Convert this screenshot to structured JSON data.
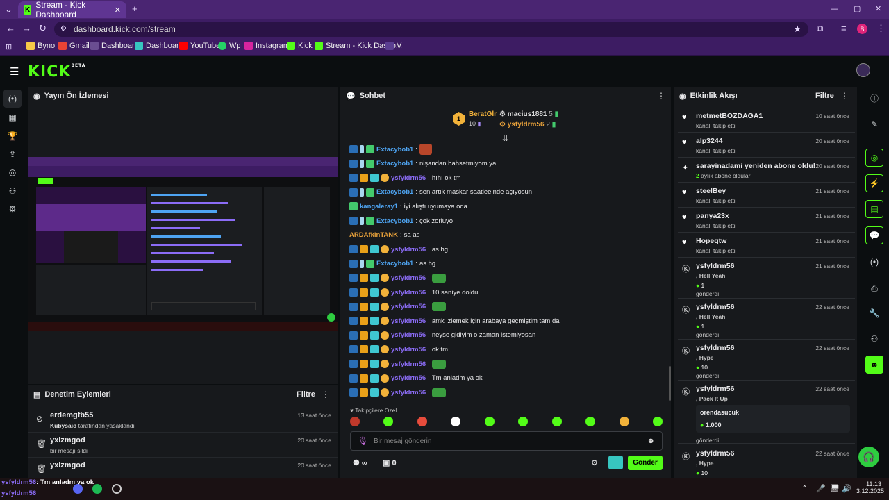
{
  "browser": {
    "tab_title": "Stream - Kick Dashboard",
    "url": "dashboard.kick.com/stream",
    "bookmarks": [
      "Byno",
      "Gmail",
      "Dashboard",
      "Dashboard",
      "YouTube",
      "Wp",
      "Instagram",
      "Kick",
      "Stream - Kick Dashb...",
      "V"
    ],
    "profile_initial": "B"
  },
  "app": {
    "logo": "KICK",
    "logo_badge": "BETA"
  },
  "preview": {
    "title": "Yayın Ön İzlemesi"
  },
  "moderation": {
    "title": "Denetim Eylemleri",
    "filter": "Filtre",
    "items": [
      {
        "user": "erdemgfb55",
        "actor": "Kubysaid",
        "action": "tarafından yasaklandı",
        "time": "13 saat önce",
        "icon": "ban-icon"
      },
      {
        "user": "yxlzmgod",
        "actor": "",
        "action": "bir mesajı sildi",
        "time": "20 saat önce",
        "icon": "trash-icon"
      },
      {
        "user": "yxlzmgod",
        "actor": "",
        "action": "",
        "time": "20 saat önce",
        "icon": "trash-icon"
      }
    ]
  },
  "chat": {
    "title": "Sohbet",
    "top_gifters": [
      {
        "rank": "1",
        "name": "BeratGlr",
        "count": "10"
      },
      {
        "name": "macius1881",
        "count": "5"
      },
      {
        "name": "ysfyldrm56",
        "count": "2"
      }
    ],
    "messages": [
      {
        "user": "Extacybob1",
        "text": "",
        "badges": [
          "tw",
          "wr",
          "gr"
        ],
        "color": "#4ea4f2",
        "emote": true
      },
      {
        "user": "Extacybob1",
        "text": "nişandan bahsetmiyom ya",
        "badges": [
          "tw",
          "wr",
          "gr"
        ],
        "color": "#4ea4f2"
      },
      {
        "user": "ysfyldrm56",
        "text": "hıhı ok tm",
        "badges": [
          "tw",
          "cr",
          "sb",
          "gf"
        ],
        "color": "#8b6cf6"
      },
      {
        "user": "Extacybob1",
        "text": "sen artık maskar saatleeinde açıyosun",
        "badges": [
          "tw",
          "wr",
          "gr"
        ],
        "color": "#4ea4f2"
      },
      {
        "user": "kangaleray1",
        "text": "iyi alıştı uyumaya oda",
        "badges": [
          "gr"
        ],
        "color": "#4ea4f2"
      },
      {
        "user": "Extacybob1",
        "text": "çok zorluyo",
        "badges": [
          "tw",
          "wr",
          "gr"
        ],
        "color": "#4ea4f2"
      },
      {
        "user": "ARDAfkinTANK",
        "text": "sa as",
        "badges": [],
        "color": "#e8a13a"
      },
      {
        "user": "ysfyldrm56",
        "text": "as hg",
        "badges": [
          "tw",
          "cr",
          "sb",
          "gf"
        ],
        "color": "#8b6cf6"
      },
      {
        "user": "Extacybob1",
        "text": "as hg",
        "badges": [
          "tw",
          "wr",
          "gr"
        ],
        "color": "#4ea4f2"
      },
      {
        "user": "ysfyldrm56",
        "text": "",
        "badges": [
          "tw",
          "cr",
          "sb",
          "gf"
        ],
        "color": "#8b6cf6",
        "emote": true
      },
      {
        "user": "ysfyldrm56",
        "text": "10 saniye doldu",
        "badges": [
          "tw",
          "cr",
          "sb",
          "gf"
        ],
        "color": "#8b6cf6"
      },
      {
        "user": "ysfyldrm56",
        "text": "",
        "badges": [
          "tw",
          "cr",
          "sb",
          "gf"
        ],
        "color": "#8b6cf6",
        "emote": true
      },
      {
        "user": "ysfyldrm56",
        "text": "amk izlemek için arabaya geçmiştim tam da",
        "badges": [
          "tw",
          "cr",
          "sb",
          "gf"
        ],
        "color": "#8b6cf6"
      },
      {
        "user": "ysfyldrm56",
        "text": "neyse gidiyim o zaman istemiyosan",
        "badges": [
          "tw",
          "cr",
          "sb",
          "gf"
        ],
        "color": "#8b6cf6"
      },
      {
        "user": "ysfyldrm56",
        "text": "ok tm",
        "badges": [
          "tw",
          "cr",
          "sb",
          "gf"
        ],
        "color": "#8b6cf6"
      },
      {
        "user": "ysfyldrm56",
        "text": "",
        "badges": [
          "tw",
          "cr",
          "sb",
          "gf"
        ],
        "color": "#8b6cf6",
        "emote": true
      },
      {
        "user": "ysfyldrm56",
        "text": "Tm anladm ya ok",
        "badges": [
          "tw",
          "cr",
          "sb",
          "gf"
        ],
        "color": "#8b6cf6"
      },
      {
        "user": "ysfyldrm56",
        "text": "",
        "badges": [
          "tw",
          "cr",
          "sb",
          "gf"
        ],
        "color": "#8b6cf6",
        "emote": true
      }
    ],
    "followers_only": "Takipçilere Özel",
    "input_placeholder": "Bir mesaj gönderin",
    "send": "Gönder",
    "store_count": "0",
    "infinity": "∞"
  },
  "activity": {
    "title": "Etkinlik Akışı",
    "filter": "Filtre",
    "items": [
      {
        "name": "metmetBOZDAGA1",
        "sub": "kanalı takip etti",
        "time": "10 saat önce",
        "icon": "heart-icon"
      },
      {
        "name": "alp3244",
        "sub": "kanalı takip etti",
        "time": "20 saat önce",
        "icon": "heart-icon"
      },
      {
        "name": "sarayinadami yeniden abone oldu!",
        "sub": "aylık abone oldular",
        "subnum": "2",
        "time": "20 saat önce",
        "icon": "sparkle-icon"
      },
      {
        "name": "steelBey",
        "sub": "kanalı takip etti",
        "time": "21 saat önce",
        "icon": "heart-icon"
      },
      {
        "name": "panya23x",
        "sub": "kanalı takip etti",
        "time": "21 saat önce",
        "icon": "heart-icon"
      },
      {
        "name": "Hopeqtw",
        "sub": "kanalı takip etti",
        "time": "21 saat önce",
        "icon": "heart-icon"
      },
      {
        "name": "ysfyldrm56",
        "gift": ", Hell Yeah",
        "amount": "1",
        "sub": "gönderdi",
        "time": "21 saat önce",
        "icon": "kick-icon"
      },
      {
        "name": "ysfyldrm56",
        "gift": ", Hell Yeah",
        "amount": "1",
        "sub": "gönderdi",
        "time": "22 saat önce",
        "icon": "kick-icon"
      },
      {
        "name": "ysfyldrm56",
        "gift": ", Hype",
        "amount": "10",
        "sub": "gönderdi",
        "time": "22 saat önce",
        "icon": "kick-icon"
      },
      {
        "name": "ysfyldrm56",
        "gift": ", Pack It Up",
        "sub": "gönderdi",
        "time": "22 saat önce",
        "icon": "kick-icon",
        "note_user": "orendasucuk",
        "note_amount": "1.000"
      },
      {
        "name": "ysfyldrm56",
        "gift": ", Hype",
        "amount": "10",
        "sub": "",
        "time": "22 saat önce",
        "icon": "kick-icon"
      }
    ]
  },
  "taskbar": {
    "overlay_line1_user": "ysfyldrm56",
    "overlay_line1_text": ": Tm anladm ya ok",
    "overlay_line2_user": "ysfyldrm56",
    "time": "11:13",
    "date": "3.12.2025"
  },
  "colors": {
    "accent": "#53fc18",
    "purple": "#4a2572",
    "panel": "#17191c"
  }
}
